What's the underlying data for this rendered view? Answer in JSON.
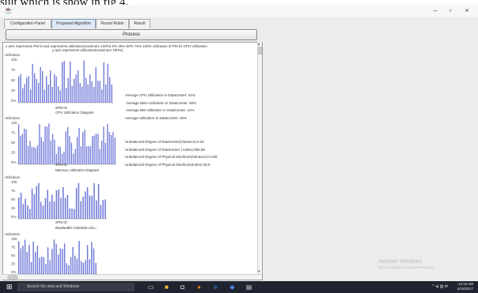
{
  "caption": "sult which is show in fig 4.",
  "window": {
    "app_icon": "java-icon",
    "minimize": "–",
    "maximize": "▫",
    "close": "×"
  },
  "tabs": [
    {
      "label": "Configuration Panel"
    },
    {
      "label": "Proposed Algorithm",
      "active": true
    },
    {
      "label": "Round Robin"
    },
    {
      "label": "Result"
    }
  ],
  "process_button": "Process",
  "panel": {
    "header": "x axis represents PM id and represents utilization(maximum 100%) 0%  25%  50%  75%  100%  utilization of PM ID  CPU Utilization",
    "subheader": "y axis represents utilization(maximum 100%)",
    "charts": [
      {
        "ylabel": "Utilization",
        "xlabel": "xPM ID",
        "title": "CPU Utilization Diagram",
        "ticks": [
          "100",
          "75",
          "50",
          "25",
          "0%"
        ]
      },
      {
        "ylabel": "Utilization",
        "xlabel": "xPM ID",
        "title": "Memory Utilization Diagram",
        "ticks": [
          "100",
          "75",
          "50",
          "25",
          "0%"
        ]
      },
      {
        "ylabel": "Utilization",
        "xlabel": "xPM ID",
        "title": "Bandwidth Utilization Dia...",
        "ticks": [
          "100",
          "75",
          "50",
          "25",
          "0%"
        ]
      },
      {
        "ylabel": "Utilization",
        "xlabel": "",
        "title": "",
        "ticks": [
          "100",
          "75",
          "50",
          "25",
          "0%"
        ]
      }
    ],
    "stats_averages": [
      "Average CPU Utilization in DataCenter:  44%",
      "Average Mem Utilization in DataCenter:  50%",
      "Average BW Utilization in DataCenter:  41%",
      "Average Utilization in DataCenter:  45%"
    ],
    "stats_unbalanced": [
      "Unbalanced Degree of DataCenter(Variance):0.23",
      "Unbalanced Degree of DataCenter ( Index):356.58",
      "Unbalanced Degree of Physical Machines(Variance):0.338",
      "Unbalanced Degree of Physical Machines(Index):48.5"
    ]
  },
  "watermark": {
    "title": "Activate Windows",
    "subtitle": "Go to Settings to activate Windows."
  },
  "taskbar": {
    "search_placeholder": "Search the web and Windows",
    "icons": [
      "task-view-icon",
      "file-explorer-icon",
      "store-icon",
      "firefox-icon",
      "edge-icon",
      "java-icon",
      "notes-icon"
    ],
    "time": "12:15 AM",
    "date": "5/15/2017"
  },
  "colors": {
    "bar": "#6f79d8",
    "taskbar": "#1f2430"
  }
}
